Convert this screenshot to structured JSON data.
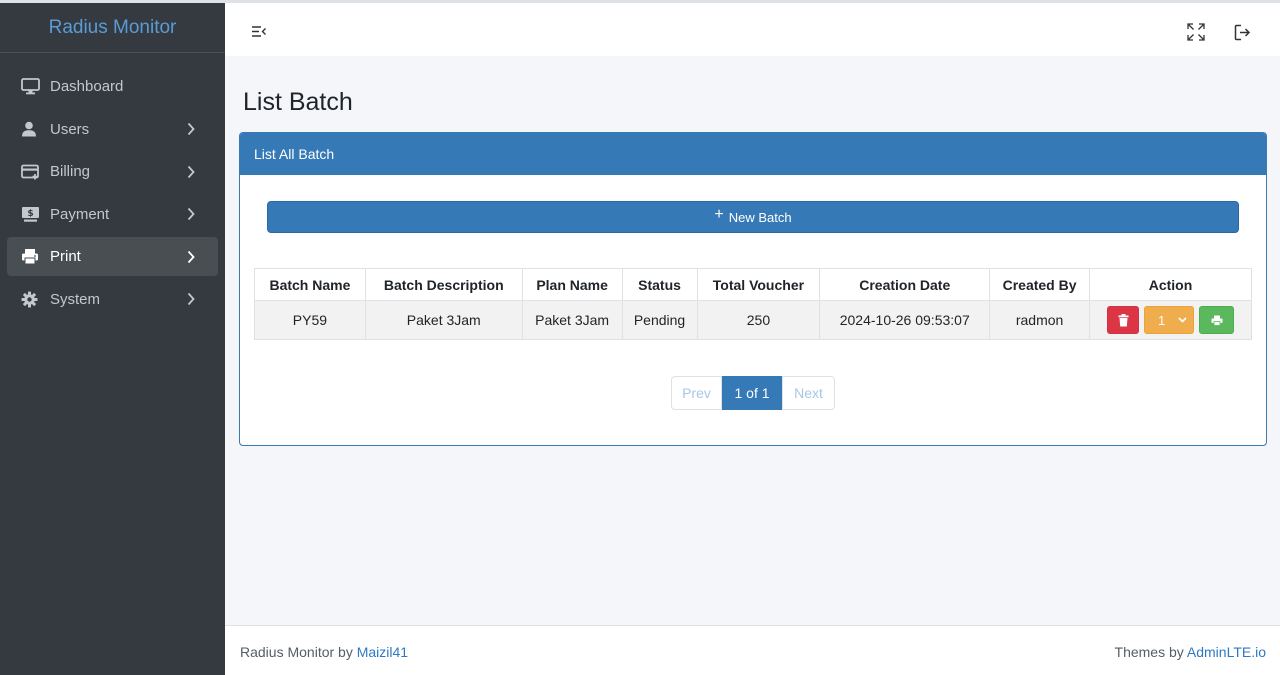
{
  "brand": {
    "title": "Radius Monitor"
  },
  "sidebar": {
    "items": [
      {
        "label": "Dashboard",
        "icon": "monitor-icon"
      },
      {
        "label": "Users",
        "icon": "user-icon"
      },
      {
        "label": "Billing",
        "icon": "credit-card-icon"
      },
      {
        "label": "Payment",
        "icon": "money-icon"
      },
      {
        "label": "Print",
        "icon": "printer-icon"
      },
      {
        "label": "System",
        "icon": "gear-icon"
      }
    ],
    "active": "Print"
  },
  "page": {
    "title": "List Batch"
  },
  "card": {
    "header": "List All Batch",
    "new_button": "New Batch"
  },
  "table": {
    "columns": [
      "Batch Name",
      "Batch Description",
      "Plan Name",
      "Status",
      "Total Voucher",
      "Creation Date",
      "Created By",
      "Action"
    ],
    "rows": [
      {
        "batch_name": "PY59",
        "description": "Paket 3Jam",
        "plan": "Paket 3Jam",
        "status": "Pending",
        "total": "250",
        "created": "2024-10-26 09:53:07",
        "by": "radmon",
        "select_value": "1"
      }
    ]
  },
  "pagination": {
    "prev": "Prev",
    "current": "1 of 1",
    "next": "Next"
  },
  "footer": {
    "left_text": "Radius Monitor by ",
    "left_link": "Maizil41",
    "right_text": "Themes by ",
    "right_link": "AdminLTE.io"
  },
  "colors": {
    "primary": "#357ab7",
    "danger": "#dc3545",
    "warning": "#f0ad4e",
    "success": "#5cb85c",
    "sidebar": "#343a40"
  }
}
